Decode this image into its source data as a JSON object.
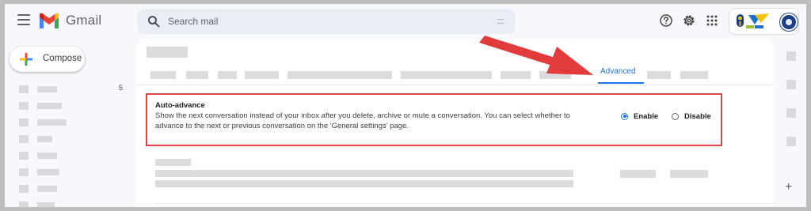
{
  "app": {
    "brand": "Gmail",
    "accent": "#1a73e8"
  },
  "search": {
    "placeholder": "Search mail"
  },
  "header_icons": [
    "help-icon",
    "gear-icon",
    "apps-grid-icon"
  ],
  "compose": {
    "label": "Compose"
  },
  "sidebar": {
    "count": "5"
  },
  "settings": {
    "active_tab": "Advanced",
    "auto_advance": {
      "title": "Auto-advance",
      "description": "Show the next conversation instead of your inbox after you delete, archive or mute a conversation. You can select whether to advance to the next or previous conversation on the 'General settings' page.",
      "options": [
        {
          "label": "Enable",
          "selected": true
        },
        {
          "label": "Disable",
          "selected": false
        }
      ]
    }
  },
  "annotation": {
    "highlight_color": "#e04444",
    "arrow_color": "#e23b3b"
  }
}
